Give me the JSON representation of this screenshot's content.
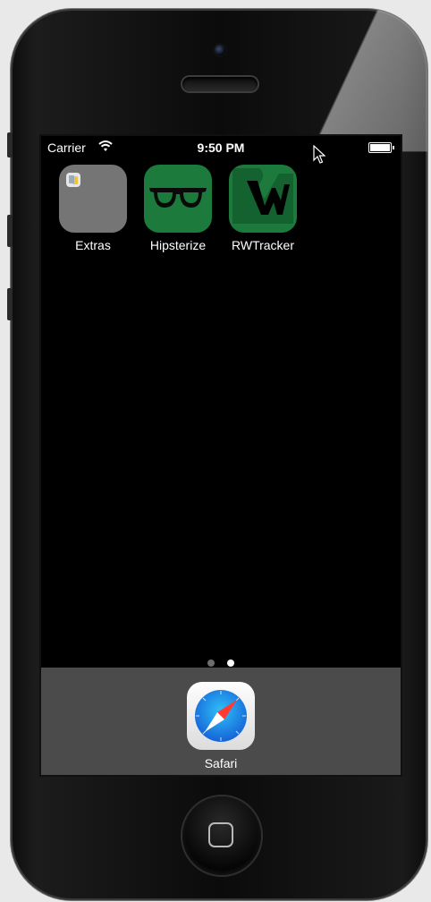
{
  "status_bar": {
    "carrier": "Carrier",
    "time": "9:50 PM",
    "wifi_icon": "wifi-icon",
    "battery_icon": "battery-icon"
  },
  "apps": [
    {
      "label": "Extras",
      "icon": "folder-icon",
      "color": "#757575"
    },
    {
      "label": "Hipsterize",
      "icon": "glasses-icon",
      "color": "#1b7a3c"
    },
    {
      "label": "RWTracker",
      "icon": "rw-logo-icon",
      "color": "#1b7a3c"
    }
  ],
  "page_indicator": {
    "pages": 2,
    "current": 2,
    "inactive_color": "#6e6e6e",
    "active_color": "#ffffff"
  },
  "dock": {
    "apps": [
      {
        "label": "Safari",
        "icon": "compass-icon"
      }
    ],
    "background": "#4b4b4b"
  },
  "device": {
    "home_button_icon": "home-square-icon",
    "cursor_icon": "mouse-pointer-icon"
  }
}
